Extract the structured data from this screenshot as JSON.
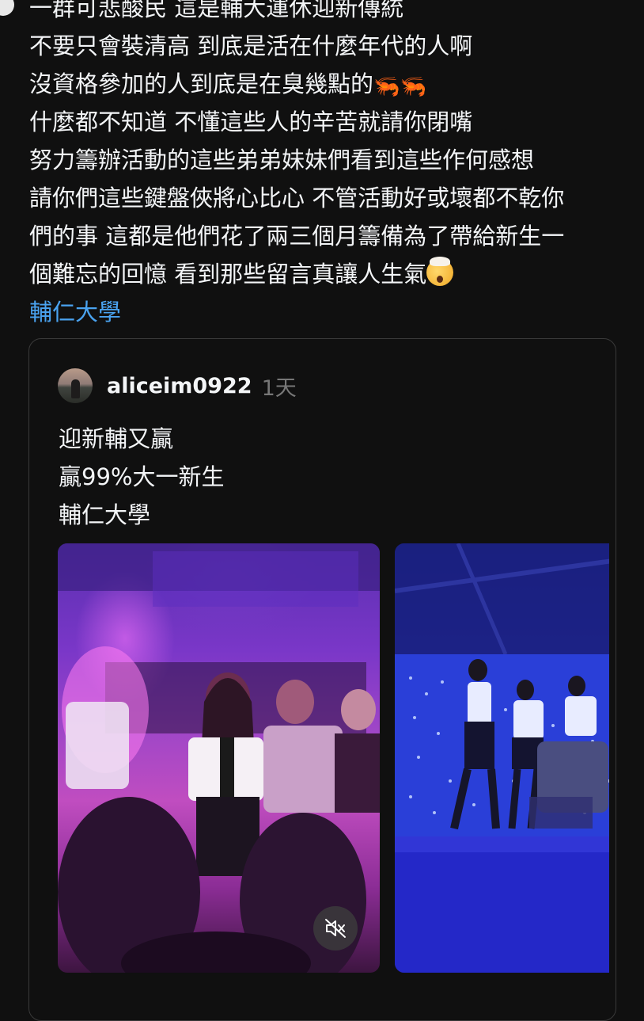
{
  "post": {
    "lines": [
      "一群可悲酸民 這是輔大運休迎新傳統",
      "不要只會裝清高 到底是活在什麼年代的人啊",
      "沒資格參加的人到底是在臭幾點的",
      "什麼都不知道 不懂這些人的辛苦就請你閉嘴",
      "努力籌辦活動的這些弟弟妹妹們看到這些作何感想",
      "請你們這些鍵盤俠將心比心 不管活動好或壞都不乾你",
      "們的事 這都是他們花了兩三個月籌備為了帶給新生一",
      "個難忘的回憶 看到那些留言真讓人生氣"
    ],
    "shrimp_emoji": "🦐",
    "face_emoji": "exploding-head-emoji",
    "tag": "輔仁大學"
  },
  "quote": {
    "username": "aliceim0922",
    "timestamp": "1天",
    "lines": [
      "迎新輔又贏",
      "贏99%大一新生"
    ],
    "tag": "輔仁大學",
    "media": [
      {
        "icon": "video-thumbnail",
        "scene": "party-crowd-purple-lights"
      },
      {
        "icon": "video-thumbnail",
        "scene": "stage-dancers-blue-lights"
      }
    ],
    "mute_icon": "speaker-muted-icon"
  },
  "colors": {
    "background": "#101010",
    "text": "#f3f5f7",
    "link": "#4aa3f0",
    "muted": "#777777",
    "card_border": "#3a3a3a"
  }
}
